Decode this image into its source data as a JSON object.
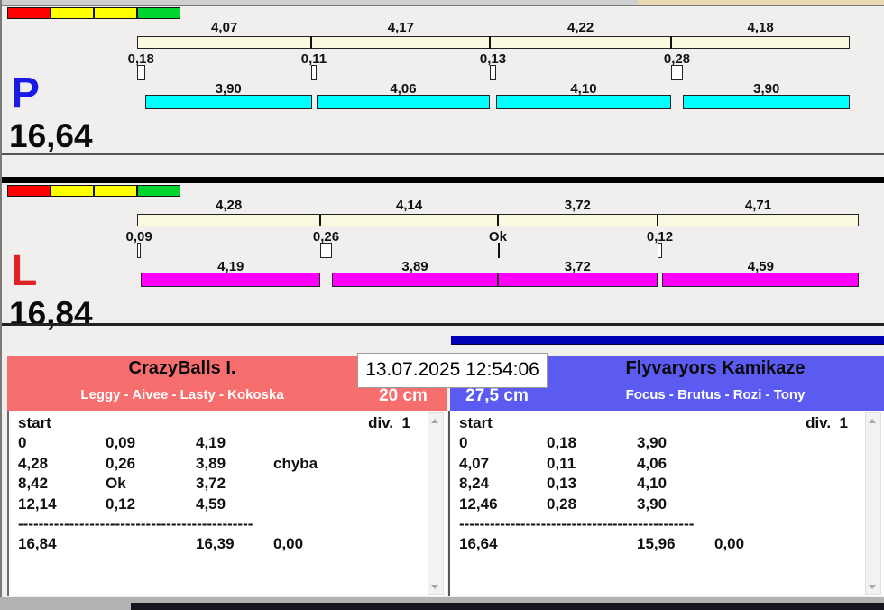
{
  "status_lights": [
    "#ff0000",
    "#ffff00",
    "#ffff00",
    "#00d42e"
  ],
  "lanes": [
    {
      "letter": "P",
      "letter_color": "#1a1ae6",
      "run_color": "#00ffff",
      "total": "16,64",
      "splits": [
        "4,07",
        "4,17",
        "4,22",
        "4,18"
      ],
      "changeovers": [
        "0,18",
        "0,11",
        "0,13",
        "0,28"
      ],
      "runs": [
        "3,90",
        "4,06",
        "4,10",
        "3,90"
      ]
    },
    {
      "letter": "L",
      "letter_color": "#e02222",
      "run_color": "#ff00ff",
      "total": "16,84",
      "splits": [
        "4,28",
        "4,14",
        "3,72",
        "4,71"
      ],
      "changeovers": [
        "0,09",
        "0,26",
        "Ok",
        "0,12"
      ],
      "runs": [
        "4,19",
        "3,89",
        "3,72",
        "4,59"
      ]
    }
  ],
  "scoreboard": {
    "timestamp": "13.07.2025 12:54:06",
    "left_team": {
      "name": "CrazyBalls I.",
      "dogs": "Leggy - Aivee - Lasty - Kokoska",
      "jump_height": "20 cm",
      "accent": "#f76e6e",
      "list": {
        "start_label": "start",
        "division_label": "div.  1",
        "rows": [
          [
            "0",
            "0,09",
            "4,19",
            ""
          ],
          [
            "4,28",
            "0,26",
            "3,89",
            "chyba"
          ],
          [
            "8,42",
            "Ok",
            "3,72",
            ""
          ],
          [
            "12,14",
            "0,12",
            "4,59",
            ""
          ]
        ],
        "separator": "----------------------------------------------",
        "totals": [
          "16,84",
          "16,39",
          "0,00"
        ]
      }
    },
    "right_team": {
      "name": "Flyvaryors Kamikaze",
      "dogs": "Focus - Brutus - Rozi - Tony",
      "jump_height": "27,5 cm",
      "accent": "#5b5bf2",
      "list": {
        "start_label": "start",
        "division_label": "div.  1",
        "rows": [
          [
            "0",
            "0,18",
            "3,90",
            ""
          ],
          [
            "4,07",
            "0,11",
            "4,06",
            ""
          ],
          [
            "8,24",
            "0,13",
            "4,10",
            ""
          ],
          [
            "12,46",
            "0,28",
            "3,90",
            ""
          ]
        ],
        "separator": "----------------------------------------------",
        "totals": [
          "16,64",
          "15,96",
          "0,00"
        ]
      }
    }
  }
}
